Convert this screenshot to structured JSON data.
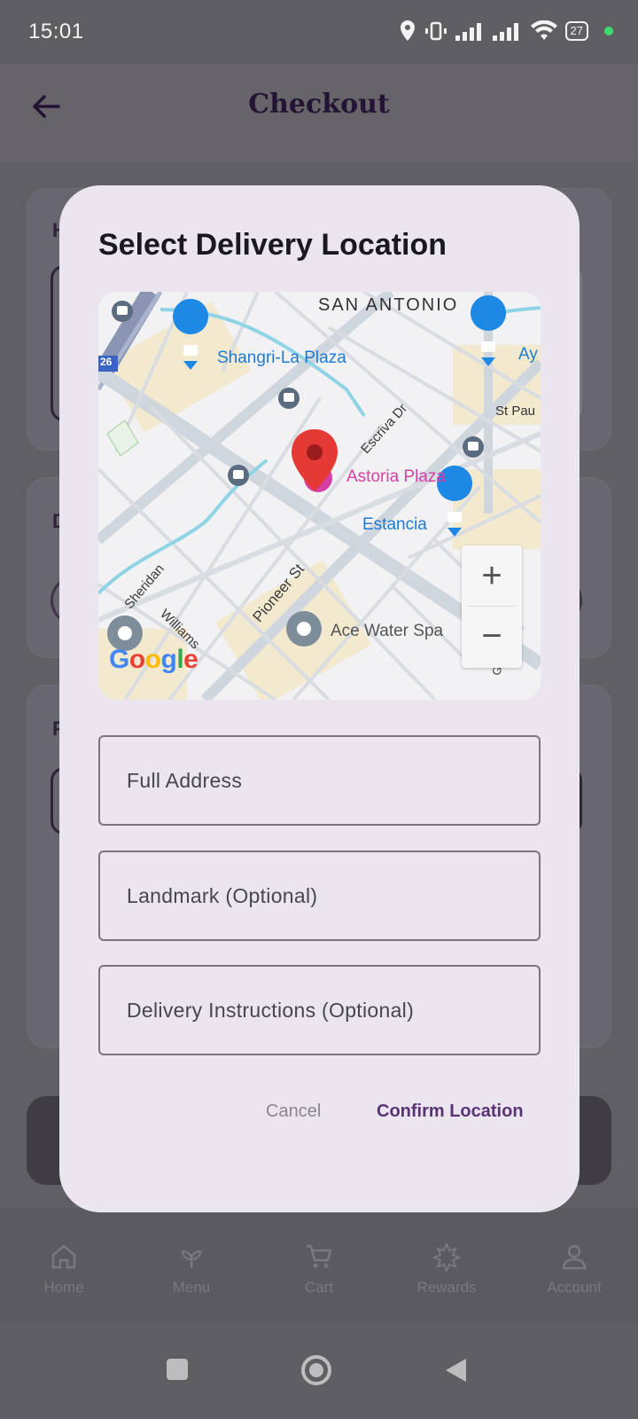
{
  "status_bar": {
    "time": "15:01",
    "battery": "27"
  },
  "header": {
    "title": "Checkout"
  },
  "background_cards": {
    "letters": [
      "H",
      "D",
      "P"
    ]
  },
  "bottom_nav": [
    {
      "label": "Home",
      "icon": "home-icon"
    },
    {
      "label": "Menu",
      "icon": "menu-leaf-icon"
    },
    {
      "label": "Cart",
      "icon": "cart-icon"
    },
    {
      "label": "Rewards",
      "icon": "rewards-icon"
    },
    {
      "label": "Account",
      "icon": "account-icon"
    }
  ],
  "dialog": {
    "title": "Select Delivery Location",
    "map": {
      "area_label": "SAN ANTONIO",
      "places": {
        "shangri_la": "Shangri-La Plaza",
        "astoria": "Astoria Plaza",
        "estancia": "Estancia",
        "ace_water_spa": "Ace Water Spa",
        "ay": "Ay",
        "st_pau": "St Pau"
      },
      "roads": {
        "escriva": "Escriva Dr",
        "pioneer": "Pioneer St",
        "sheridan": "Sheridan",
        "williams": "Williams",
        "granbo": "Granbo Dr",
        "route": "26"
      },
      "zoom_in": "+",
      "zoom_out": "−",
      "google": "Google"
    },
    "fields": {
      "full_address": "Full Address",
      "landmark": "Landmark (Optional)",
      "instructions": "Delivery Instructions (Optional)"
    },
    "cancel_label": "Cancel",
    "confirm_label": "Confirm Location"
  },
  "colors": {
    "accent": "#5a3374",
    "dialog_bg": "#ebe5f0",
    "pin_red": "#e53935",
    "place_blue": "#1e88e5",
    "place_pink": "#d63fa6"
  }
}
